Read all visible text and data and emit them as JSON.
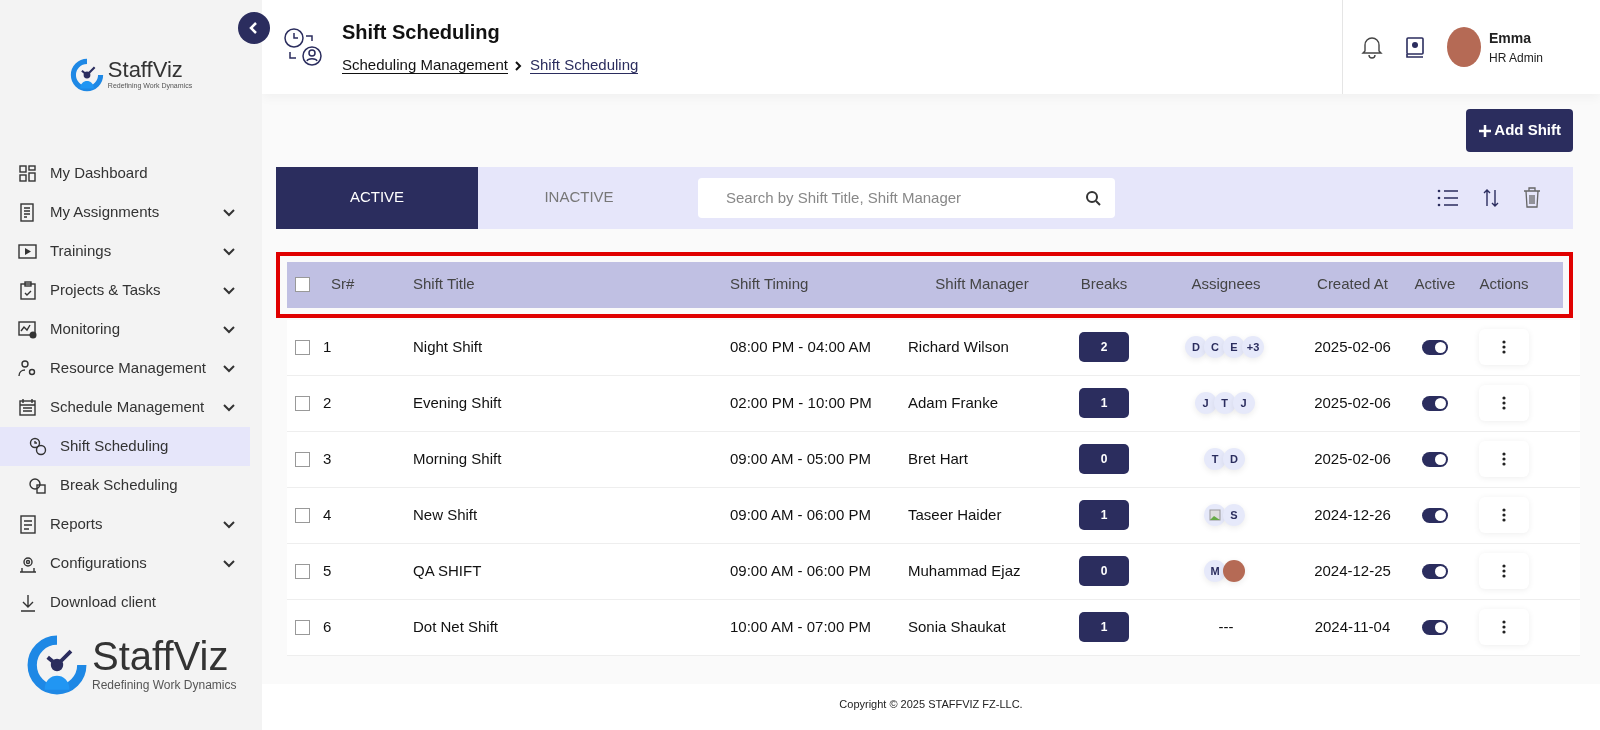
{
  "sidebar": {
    "brand": {
      "name": "StaffViz",
      "tagline": "Redefining Work Dynamics"
    },
    "items": [
      {
        "label": "My Dashboard",
        "expandable": false,
        "selected": false
      },
      {
        "label": "My Assignments",
        "expandable": true,
        "selected": false
      },
      {
        "label": "Trainings",
        "expandable": true,
        "selected": false
      },
      {
        "label": "Projects & Tasks",
        "expandable": true,
        "selected": false
      },
      {
        "label": "Monitoring",
        "expandable": true,
        "selected": false
      },
      {
        "label": "Resource Management",
        "expandable": true,
        "selected": false
      },
      {
        "label": "Schedule Management",
        "expandable": true,
        "selected": false,
        "children": [
          {
            "label": "Shift Scheduling",
            "selected": true
          },
          {
            "label": "Break Scheduling",
            "selected": false
          }
        ]
      },
      {
        "label": "Reports",
        "expandable": true,
        "selected": false
      },
      {
        "label": "Configurations",
        "expandable": true,
        "selected": false
      },
      {
        "label": "Download client",
        "expandable": false,
        "selected": false
      }
    ],
    "footer_brand": {
      "name": "StaffViz",
      "tagline": "Redefining Work Dynamics"
    }
  },
  "header": {
    "title": "Shift Scheduling",
    "breadcrumb": [
      "Scheduling Management",
      "Shift Scheduling"
    ],
    "user": {
      "name": "Emma",
      "role": "HR Admin"
    }
  },
  "add_button": "Add Shift",
  "tabs": [
    {
      "label": "ACTIVE",
      "selected": true
    },
    {
      "label": "INACTIVE",
      "selected": false
    }
  ],
  "search": {
    "placeholder": "Search by Shift Title, Shift Manager"
  },
  "table": {
    "highlighted": true,
    "columns": [
      "Sr#",
      "Shift Title",
      "Shift Timing",
      "Shift Manager",
      "Breaks",
      "Assignees",
      "Created At",
      "Active",
      "Actions"
    ],
    "rows": [
      {
        "sr": "1",
        "title": "Night Shift",
        "timing": "08:00 PM - 04:00 AM",
        "manager": "Richard Wilson",
        "breaks": "2",
        "assignees": [
          {
            "kind": "initial",
            "text": "D"
          },
          {
            "kind": "initial",
            "text": "C"
          },
          {
            "kind": "initial",
            "text": "E"
          },
          {
            "kind": "more",
            "text": "+3"
          }
        ],
        "created": "2025-02-06",
        "active": true,
        "checked": false
      },
      {
        "sr": "2",
        "title": "Evening Shift",
        "timing": "02:00 PM - 10:00 PM",
        "manager": "Adam Franke",
        "breaks": "1",
        "assignees": [
          {
            "kind": "initial",
            "text": "J"
          },
          {
            "kind": "initial",
            "text": "T"
          },
          {
            "kind": "initial",
            "text": "J"
          }
        ],
        "created": "2025-02-06",
        "active": true,
        "checked": false
      },
      {
        "sr": "3",
        "title": "Morning Shift",
        "timing": "09:00 AM - 05:00 PM",
        "manager": "Bret Hart",
        "breaks": "0",
        "assignees": [
          {
            "kind": "initial",
            "text": "T"
          },
          {
            "kind": "initial",
            "text": "D"
          }
        ],
        "created": "2025-02-06",
        "active": true,
        "checked": false
      },
      {
        "sr": "4",
        "title": "New Shift",
        "timing": "09:00 AM - 06:00 PM",
        "manager": "Taseer Haider",
        "breaks": "1",
        "assignees": [
          {
            "kind": "image"
          },
          {
            "kind": "initial",
            "text": "S"
          }
        ],
        "created": "2024-12-26",
        "active": true,
        "checked": false
      },
      {
        "sr": "5",
        "title": "QA SHIFT",
        "timing": "09:00 AM - 06:00 PM",
        "manager": "Muhammad Ejaz",
        "breaks": "0",
        "assignees": [
          {
            "kind": "initial",
            "text": "M"
          },
          {
            "kind": "photo"
          }
        ],
        "created": "2024-12-25",
        "active": true,
        "checked": false
      },
      {
        "sr": "6",
        "title": "Dot Net Shift",
        "timing": "10:00 AM - 07:00 PM",
        "manager": "Sonia Shaukat",
        "breaks": "1",
        "empty_assignees": "---",
        "assignees": [],
        "created": "2024-11-04",
        "active": true,
        "checked": false
      }
    ]
  },
  "copyright": "Copyright © 2025 STAFFVIZ FZ-LLC."
}
